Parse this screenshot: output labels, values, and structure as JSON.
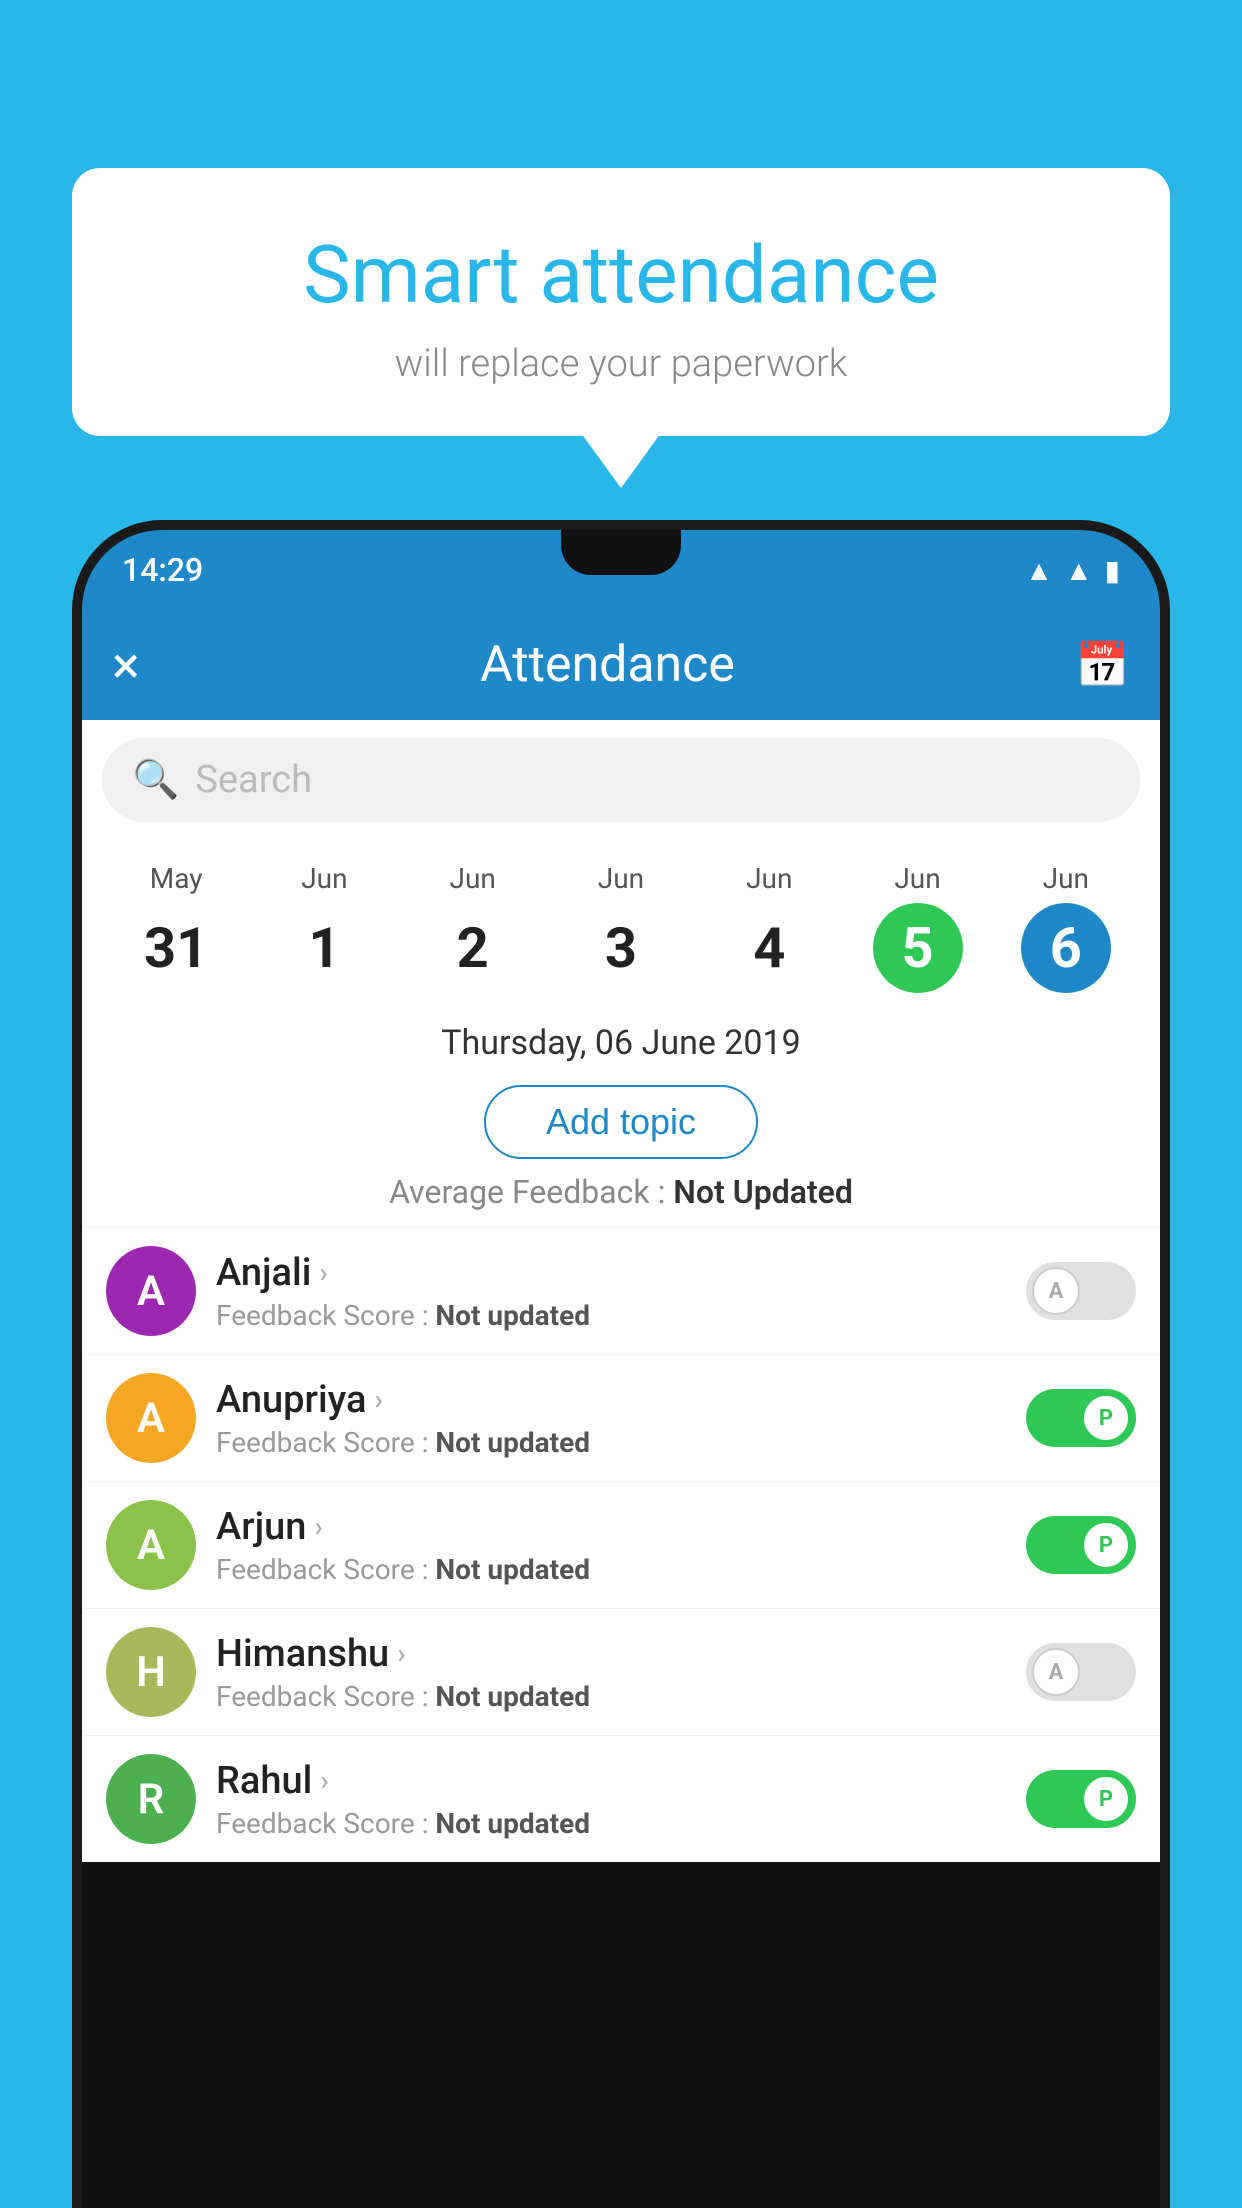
{
  "background_color": "#29b6e8",
  "bubble": {
    "title": "Smart attendance",
    "subtitle": "will replace your paperwork"
  },
  "status_bar": {
    "time": "14:29",
    "icons": [
      "wifi",
      "signal",
      "battery"
    ]
  },
  "toolbar": {
    "close_label": "×",
    "title": "Attendance",
    "calendar_icon": "📅"
  },
  "search": {
    "placeholder": "Search"
  },
  "dates": [
    {
      "month": "May",
      "day": "31",
      "style": "normal"
    },
    {
      "month": "Jun",
      "day": "1",
      "style": "normal"
    },
    {
      "month": "Jun",
      "day": "2",
      "style": "normal"
    },
    {
      "month": "Jun",
      "day": "3",
      "style": "normal"
    },
    {
      "month": "Jun",
      "day": "4",
      "style": "normal"
    },
    {
      "month": "Jun",
      "day": "5",
      "style": "today"
    },
    {
      "month": "Jun",
      "day": "6",
      "style": "selected"
    }
  ],
  "selected_date": "Thursday, 06 June 2019",
  "add_topic_label": "Add topic",
  "avg_feedback_label": "Average Feedback :",
  "avg_feedback_value": "Not Updated",
  "students": [
    {
      "name": "Anjali",
      "initial": "A",
      "avatar_color": "#9c27b0",
      "feedback_label": "Feedback Score :",
      "feedback_value": "Not updated",
      "toggle": "off",
      "toggle_letter": "A"
    },
    {
      "name": "Anupriya",
      "initial": "A",
      "avatar_color": "#f5a623",
      "feedback_label": "Feedback Score :",
      "feedback_value": "Not updated",
      "toggle": "on",
      "toggle_letter": "P"
    },
    {
      "name": "Arjun",
      "initial": "A",
      "avatar_color": "#8bc34a",
      "feedback_label": "Feedback Score :",
      "feedback_value": "Not updated",
      "toggle": "on",
      "toggle_letter": "P"
    },
    {
      "name": "Himanshu",
      "initial": "H",
      "avatar_color": "#aab85c",
      "feedback_label": "Feedback Score :",
      "feedback_value": "Not updated",
      "toggle": "off",
      "toggle_letter": "A"
    },
    {
      "name": "Rahul",
      "initial": "R",
      "avatar_color": "#4caf50",
      "feedback_label": "Feedback Score :",
      "feedback_value": "Not updated",
      "toggle": "on",
      "toggle_letter": "P"
    }
  ]
}
